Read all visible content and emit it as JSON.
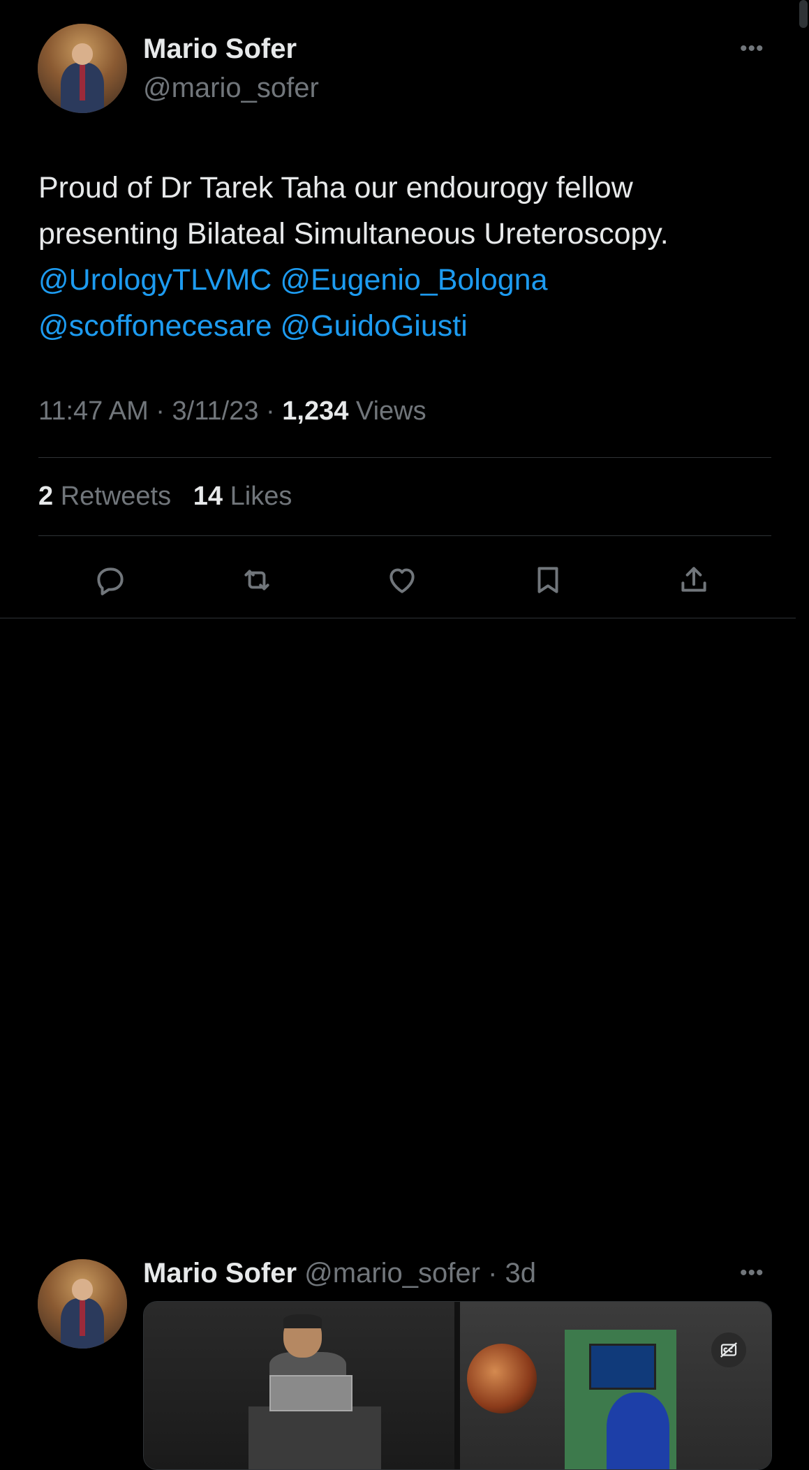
{
  "tweet": {
    "author_name": "Mario Sofer",
    "author_handle": "@mario_sofer",
    "more_label": "•••",
    "text_plain": "Proud of Dr Tarek Taha our endourogy fellow presenting Bilateal Simultaneous Ureteroscopy.",
    "mentions": [
      "@UrologyTLVMC",
      "@Eugenio_Bologna",
      "@scoffonecesare",
      "@GuidoGiusti"
    ],
    "time": "11:47 AM",
    "date": "3/11/23",
    "views_count": "1,234",
    "views_label": "Views",
    "retweets_count": "2",
    "retweets_label": "Retweets",
    "likes_count": "14",
    "likes_label": "Likes",
    "separator": " · "
  },
  "actions": [
    {
      "name": "reply-icon"
    },
    {
      "name": "retweet-icon"
    },
    {
      "name": "like-icon"
    },
    {
      "name": "bookmark-icon"
    },
    {
      "name": "share-icon"
    }
  ],
  "reply": {
    "author_name": "Mario Sofer",
    "author_handle": "@mario_sofer",
    "age": "3d",
    "more_label": "•••",
    "media_badge": "captions-off-icon"
  },
  "colors": {
    "background": "#000000",
    "text": "#e7e9ea",
    "secondary": "#71767b",
    "link": "#1d9bf0",
    "divider": "#2f3336"
  }
}
